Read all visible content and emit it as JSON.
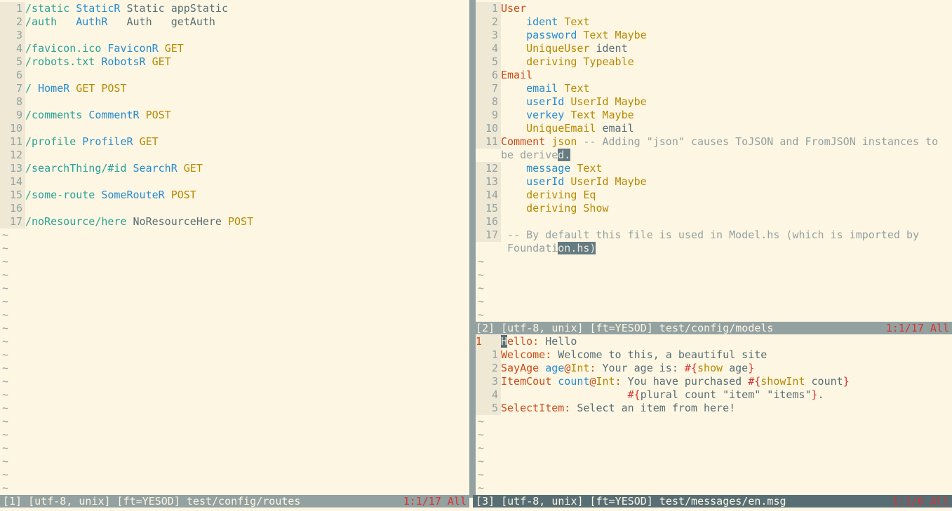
{
  "windows": {
    "routes": {
      "status_left": "[1] [utf-8, unix] [ft=YESOD] test/config/routes",
      "status_right": "1:1/17 All",
      "tilde": "~",
      "lines": [
        {
          "n": "1",
          "segs": [
            {
              "t": "/static ",
              "c": "o"
            },
            {
              "t": "StaticR ",
              "c": "b"
            },
            {
              "t": "Static appStatic",
              "c": "f"
            }
          ]
        },
        {
          "n": "2",
          "segs": [
            {
              "t": "/auth   ",
              "c": "o"
            },
            {
              "t": "AuthR   ",
              "c": "b"
            },
            {
              "t": "Auth   getAuth",
              "c": "f"
            }
          ]
        },
        {
          "n": "3",
          "segs": []
        },
        {
          "n": "4",
          "segs": [
            {
              "t": "/favicon.ico ",
              "c": "o"
            },
            {
              "t": "FaviconR ",
              "c": "b"
            },
            {
              "t": "GET",
              "c": "y"
            }
          ]
        },
        {
          "n": "5",
          "segs": [
            {
              "t": "/robots.txt ",
              "c": "o"
            },
            {
              "t": "RobotsR ",
              "c": "b"
            },
            {
              "t": "GET",
              "c": "y"
            }
          ]
        },
        {
          "n": "6",
          "segs": []
        },
        {
          "n": "7",
          "segs": [
            {
              "t": "/ ",
              "c": "o"
            },
            {
              "t": "HomeR ",
              "c": "b"
            },
            {
              "t": "GET POST",
              "c": "y"
            }
          ]
        },
        {
          "n": "8",
          "segs": []
        },
        {
          "n": "9",
          "segs": [
            {
              "t": "/comments ",
              "c": "o"
            },
            {
              "t": "CommentR ",
              "c": "b"
            },
            {
              "t": "POST",
              "c": "y"
            }
          ]
        },
        {
          "n": "10",
          "segs": []
        },
        {
          "n": "11",
          "segs": [
            {
              "t": "/profile ",
              "c": "o"
            },
            {
              "t": "ProfileR ",
              "c": "b"
            },
            {
              "t": "GET",
              "c": "y"
            }
          ]
        },
        {
          "n": "12",
          "segs": []
        },
        {
          "n": "13",
          "segs": [
            {
              "t": "/searchThing/#id ",
              "c": "o"
            },
            {
              "t": "SearchR ",
              "c": "b"
            },
            {
              "t": "GET",
              "c": "y"
            }
          ]
        },
        {
          "n": "14",
          "segs": []
        },
        {
          "n": "15",
          "segs": [
            {
              "t": "/some-route ",
              "c": "o"
            },
            {
              "t": "SomeRouteR ",
              "c": "b"
            },
            {
              "t": "POST",
              "c": "y"
            }
          ]
        },
        {
          "n": "16",
          "segs": []
        },
        {
          "n": "17",
          "segs": [
            {
              "t": "/noResource/here ",
              "c": "o"
            },
            {
              "t": "NoResourceHere ",
              "c": "f"
            },
            {
              "t": "POST",
              "c": "y"
            }
          ]
        }
      ]
    },
    "models": {
      "status_left": "[2] [utf-8, unix] [ft=YESOD] test/config/models",
      "status_right": "1:1/17 All",
      "tilde": "~",
      "lines": [
        {
          "n": "1",
          "segs": [
            {
              "t": "User",
              "c": "oc"
            }
          ]
        },
        {
          "n": "2",
          "segs": [
            {
              "t": "    ident ",
              "c": "b"
            },
            {
              "t": "Text",
              "c": "y"
            }
          ]
        },
        {
          "n": "3",
          "segs": [
            {
              "t": "    password ",
              "c": "b"
            },
            {
              "t": "Text Maybe",
              "c": "y"
            }
          ]
        },
        {
          "n": "4",
          "segs": [
            {
              "t": "    UniqueUser ",
              "c": "y"
            },
            {
              "t": "ident",
              "c": "f"
            }
          ]
        },
        {
          "n": "5",
          "segs": [
            {
              "t": "    deriving Typeable",
              "c": "y"
            }
          ]
        },
        {
          "n": "6",
          "segs": [
            {
              "t": "Email",
              "c": "oc"
            }
          ]
        },
        {
          "n": "7",
          "segs": [
            {
              "t": "    email ",
              "c": "b"
            },
            {
              "t": "Text",
              "c": "y"
            }
          ]
        },
        {
          "n": "8",
          "segs": [
            {
              "t": "    userId ",
              "c": "b"
            },
            {
              "t": "UserId Maybe",
              "c": "y"
            }
          ]
        },
        {
          "n": "9",
          "segs": [
            {
              "t": "    verkey ",
              "c": "b"
            },
            {
              "t": "Text Maybe",
              "c": "y"
            }
          ]
        },
        {
          "n": "10",
          "segs": [
            {
              "t": "    UniqueEmail ",
              "c": "y"
            },
            {
              "t": "email",
              "c": "f"
            }
          ]
        },
        {
          "n": "11",
          "segs": [
            {
              "t": "Comment ",
              "c": "oc"
            },
            {
              "t": "json ",
              "c": "y"
            },
            {
              "t": "-- Adding \"json\" causes ToJSON and FromJSON instances to",
              "c": "g"
            }
          ]
        },
        {
          "n": "",
          "segs": [
            {
              "t": "be derive",
              "c": "g"
            },
            {
              "t": "d.",
              "c": "vis"
            }
          ]
        },
        {
          "n": "12",
          "segs": [
            {
              "t": "    message ",
              "c": "b"
            },
            {
              "t": "Text",
              "c": "y"
            }
          ]
        },
        {
          "n": "13",
          "segs": [
            {
              "t": "    userId ",
              "c": "b"
            },
            {
              "t": "UserId Maybe",
              "c": "y"
            }
          ]
        },
        {
          "n": "14",
          "segs": [
            {
              "t": "    deriving Eq",
              "c": "y"
            }
          ]
        },
        {
          "n": "15",
          "segs": [
            {
              "t": "    deriving Show",
              "c": "y"
            }
          ]
        },
        {
          "n": "16",
          "segs": []
        },
        {
          "n": "17",
          "segs": [
            {
              "t": " -- By default this file is used in Model.hs (which is imported by",
              "c": "g"
            }
          ]
        },
        {
          "n": "",
          "segs": [
            {
              "t": " Foundati",
              "c": "g"
            },
            {
              "t": "on.hs)",
              "c": "vis"
            }
          ]
        }
      ]
    },
    "messages": {
      "status_left": "[3] [utf-8, unix] [ft=YESOD] test/messages/en.msg",
      "status_right": "1:1/6 All",
      "tilde": "~",
      "lines": [
        {
          "n": "1",
          "current": true,
          "segs": [
            {
              "t": "H",
              "c": "cur"
            },
            {
              "t": "ello: ",
              "c": "oc"
            },
            {
              "t": "Hello",
              "c": "f"
            }
          ]
        },
        {
          "n": "1",
          "segs": [
            {
              "t": "Welcome: ",
              "c": "oc"
            },
            {
              "t": "Welcome to this, a beautiful site",
              "c": "f"
            }
          ]
        },
        {
          "n": "2",
          "segs": [
            {
              "t": "SayAge ",
              "c": "oc"
            },
            {
              "t": "age",
              "c": "b"
            },
            {
              "t": "@",
              "c": "oc"
            },
            {
              "t": "Int",
              "c": "y"
            },
            {
              "t": ": ",
              "c": "oc"
            },
            {
              "t": "Your age is: ",
              "c": "f"
            },
            {
              "t": "#{",
              "c": "r"
            },
            {
              "t": "show",
              "c": "y"
            },
            {
              "t": " age",
              "c": "f"
            },
            {
              "t": "}",
              "c": "r"
            }
          ]
        },
        {
          "n": "3",
          "segs": [
            {
              "t": "ItemCout ",
              "c": "oc"
            },
            {
              "t": "count",
              "c": "b"
            },
            {
              "t": "@",
              "c": "oc"
            },
            {
              "t": "Int",
              "c": "y"
            },
            {
              "t": ": ",
              "c": "oc"
            },
            {
              "t": "You have purchased ",
              "c": "f"
            },
            {
              "t": "#{",
              "c": "r"
            },
            {
              "t": "showInt",
              "c": "y"
            },
            {
              "t": " count",
              "c": "f"
            },
            {
              "t": "}",
              "c": "r"
            }
          ]
        },
        {
          "n": "4",
          "segs": [
            {
              "t": "                    ",
              "c": "f"
            },
            {
              "t": "#{",
              "c": "r"
            },
            {
              "t": "plural count \"item\" \"items\"",
              "c": "f"
            },
            {
              "t": "}",
              "c": "r"
            },
            {
              "t": ".",
              "c": "f"
            }
          ]
        },
        {
          "n": "5",
          "segs": [
            {
              "t": "SelectItem: ",
              "c": "oc"
            },
            {
              "t": "Select an item from here!",
              "c": "f"
            }
          ]
        }
      ]
    }
  }
}
